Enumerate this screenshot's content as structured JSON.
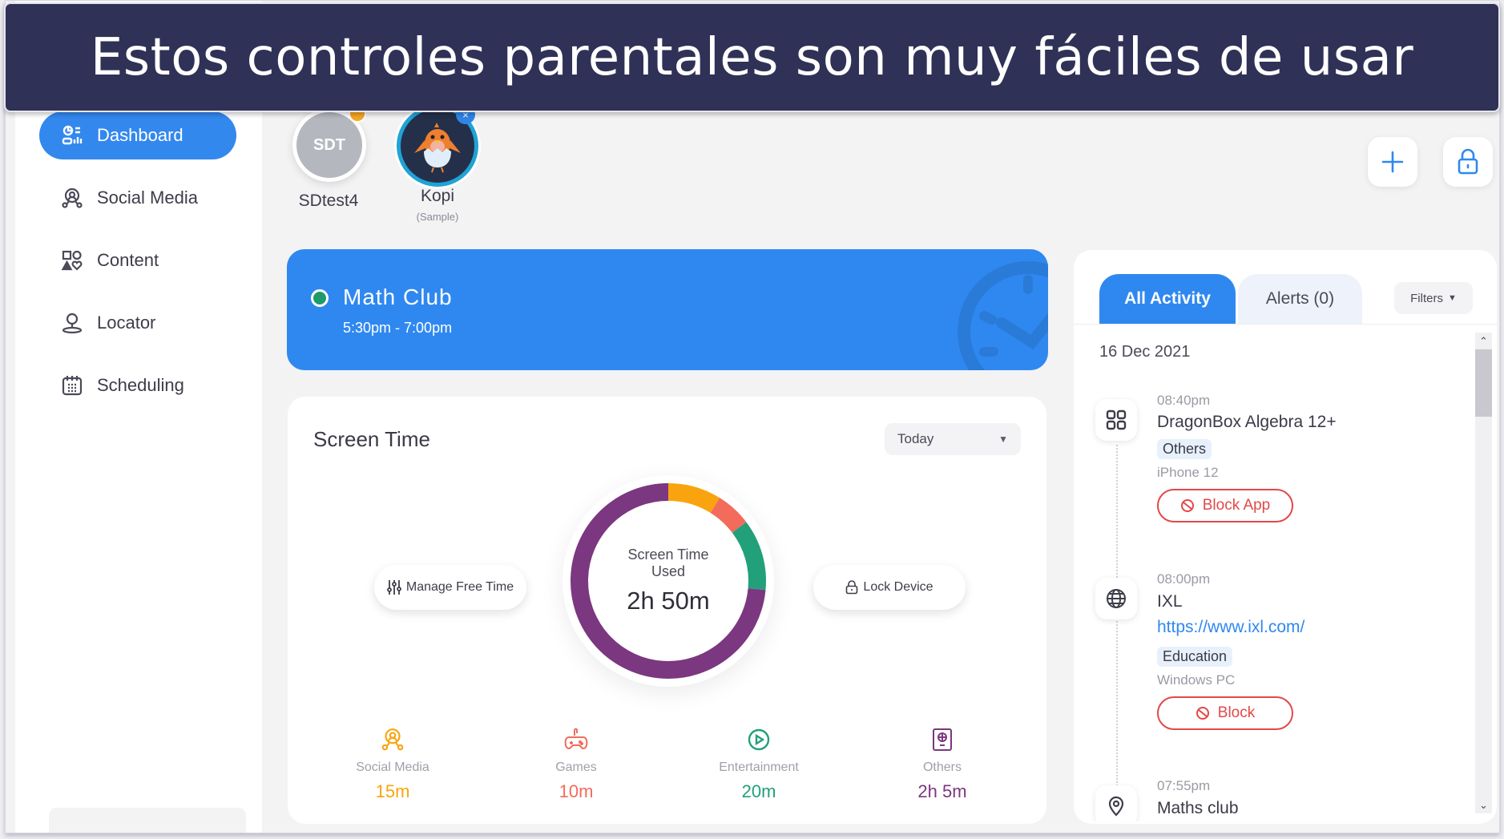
{
  "banner": {
    "text": "Estos controles parentales son muy fáciles de usar"
  },
  "sidebar": {
    "items": [
      {
        "label": "Dashboard",
        "icon": "dashboard-icon",
        "active": true
      },
      {
        "label": "Social Media",
        "icon": "social-media-icon"
      },
      {
        "label": "Content",
        "icon": "content-icon"
      },
      {
        "label": "Locator",
        "icon": "locator-icon"
      },
      {
        "label": "Scheduling",
        "icon": "calendar-icon"
      }
    ]
  },
  "profiles": [
    {
      "initials": "SDT",
      "name": "SDtest4",
      "badge_color": "#f5a623"
    },
    {
      "name": "Kopi",
      "sub": "(Sample)",
      "badge": "×"
    }
  ],
  "header_actions": {
    "add_icon": "plus-icon",
    "lock_icon": "lock-icon"
  },
  "event": {
    "title": "Math Club",
    "time": "5:30pm - 7:00pm",
    "status_color": "#1e9a6c"
  },
  "screen_time": {
    "title": "Screen Time",
    "period": "Today",
    "manage_label": "Manage Free Time",
    "lock_label": "Lock Device",
    "center_label": "Screen Time Used",
    "total": "2h 50m",
    "categories": [
      {
        "label": "Social Media",
        "value": "15m",
        "minutes": 15,
        "color": "#f9a40e",
        "icon": "social-media-icon"
      },
      {
        "label": "Games",
        "value": "10m",
        "minutes": 10,
        "color": "#f26b5b",
        "icon": "gamepad-icon"
      },
      {
        "label": "Entertainment",
        "value": "20m",
        "minutes": 20,
        "color": "#22a07a",
        "icon": "play-icon"
      },
      {
        "label": "Others",
        "value": "2h 5m",
        "minutes": 125,
        "color": "#7b377f",
        "icon": "others-icon"
      }
    ]
  },
  "activity": {
    "tabs": [
      {
        "label": "All Activity",
        "active": true
      },
      {
        "label": "Alerts (0)"
      }
    ],
    "filters_label": "Filters",
    "date": "16 Dec 2021",
    "items": [
      {
        "icon": "apps-icon",
        "time": "08:40pm",
        "title": "DragonBox Algebra 12+",
        "tag": "Others",
        "device": "iPhone 12",
        "action": "Block App"
      },
      {
        "icon": "globe-icon",
        "time": "08:00pm",
        "title": "IXL",
        "link": "https://www.ixl.com/",
        "tag": "Education",
        "device": "Windows PC",
        "action": "Block"
      },
      {
        "icon": "location-pin-icon",
        "time": "07:55pm",
        "title": "Maths club"
      }
    ]
  }
}
